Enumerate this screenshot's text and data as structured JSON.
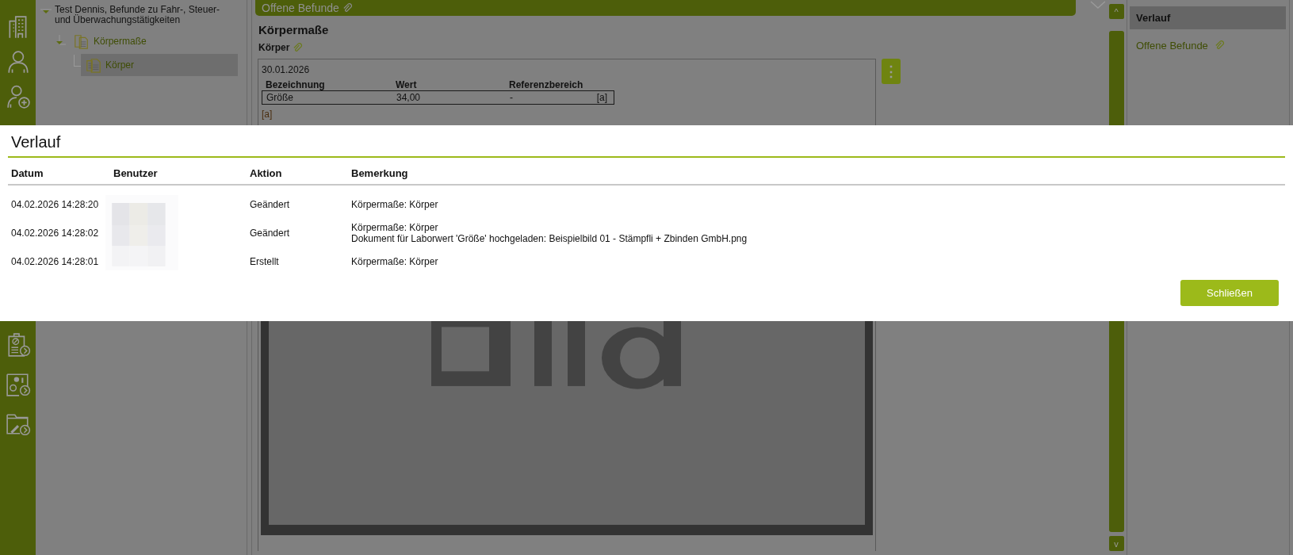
{
  "tree": [
    {
      "label": "Test Dennis, Befunde zu Fahr-, Steuer- und Überwachungstätigkeiten",
      "expanded": true,
      "selected": false,
      "children": [
        {
          "label": "Körpermaße",
          "expanded": true,
          "selected": false,
          "children": [
            {
              "label": "Körper",
              "selected": true
            }
          ]
        }
      ]
    }
  ],
  "header_bar": {
    "title": "Offene Befunde",
    "attachment": true
  },
  "section": {
    "title": "Körpermaße",
    "subtitle": "Körper",
    "attachment": true,
    "card": {
      "date": "30.01.2026",
      "columns": [
        "Bezeichnung",
        "Wert",
        "Referenzbereich"
      ],
      "rows": [
        {
          "cells": [
            "Größe",
            "34,00",
            "-"
          ],
          "note_ref": "[a]"
        }
      ],
      "footnote": "[a]",
      "menu_button": "⋮"
    }
  },
  "scrollbar": {
    "up": "^",
    "down": "v"
  },
  "right_panel": {
    "items": [
      {
        "label": "Verlauf",
        "selected": true
      },
      {
        "label": "Offene Befunde",
        "selected": false,
        "attachment": true
      }
    ]
  },
  "dialog": {
    "title": "Verlauf",
    "columns": [
      "Datum",
      "Benutzer",
      "Aktion",
      "Bemerkung"
    ],
    "rows": [
      {
        "datum": "04.02.2026 14:28:20",
        "aktion": "Geändert",
        "bemerkung": [
          "Körpermaße: Körper"
        ]
      },
      {
        "datum": "04.02.2026 14:28:02",
        "aktion": "Geändert",
        "bemerkung": [
          "Körpermaße: Körper",
          "Dokument für Laborwert 'Größe' hochgeladen: Beispielbild 01 - Stämpfli + Zbinden GmbH.png"
        ]
      },
      {
        "datum": "04.02.2026 14:28:01",
        "aktion": "Erstellt",
        "bemerkung": [
          "Körpermaße: Körper"
        ]
      }
    ],
    "button": "Schließen"
  }
}
